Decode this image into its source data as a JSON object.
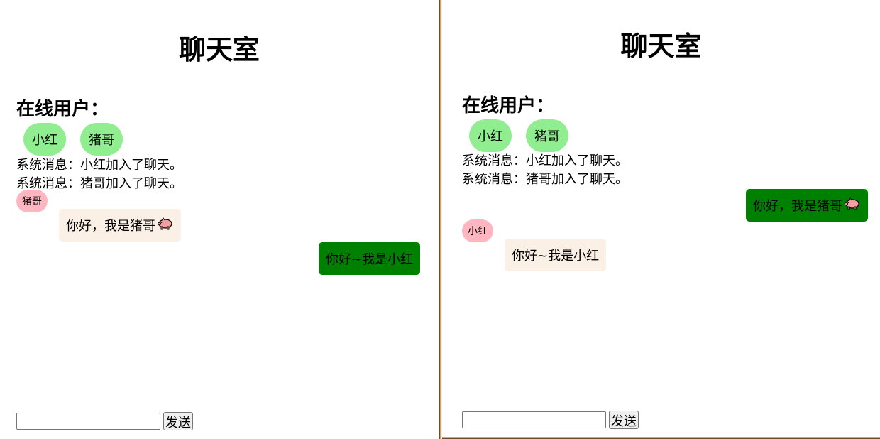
{
  "colors": {
    "online_pill": "#90ee90",
    "sender_tag": "#ffb6c1",
    "incoming_bubble": "#faf0e6",
    "outgoing_bubble": "#008000"
  },
  "left": {
    "title": "聊天室",
    "online_heading": "在线用户：",
    "users": [
      "小红",
      "猪哥"
    ],
    "system_messages": [
      "系统消息：小红加入了聊天。",
      "系统消息：猪哥加入了聊天。"
    ],
    "incoming": {
      "sender": "猪哥",
      "text": "你好，我是猪哥",
      "emoji": "pig-icon"
    },
    "outgoing": {
      "text": "你好~我是小红"
    },
    "composer": {
      "value": "",
      "send_label": "发送"
    }
  },
  "right": {
    "title": "聊天室",
    "online_heading": "在线用户：",
    "users": [
      "小红",
      "猪哥"
    ],
    "system_messages": [
      "系统消息：小红加入了聊天。",
      "系统消息：猪哥加入了聊天。"
    ],
    "outgoing": {
      "text": "你好，我是猪哥",
      "emoji": "pig-icon"
    },
    "incoming": {
      "sender": "小红",
      "text": "你好~我是小红"
    },
    "composer": {
      "value": "",
      "send_label": "发送"
    }
  }
}
